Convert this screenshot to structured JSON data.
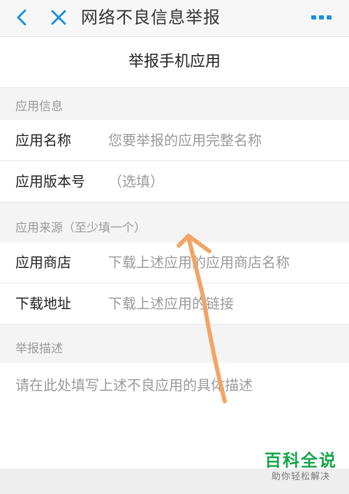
{
  "nav": {
    "title": "网络不良信息举报",
    "back_icon": "chevron-left-icon",
    "close_icon": "close-icon",
    "more_icon": "more-dots-icon",
    "accent_color": "#1a8fe3"
  },
  "subhead": {
    "title": "举报手机应用"
  },
  "sections": {
    "app_info": "应用信息",
    "app_source": "应用来源（至少填一个）",
    "report_desc": "举报描述"
  },
  "fields": {
    "app_name": {
      "label": "应用名称",
      "placeholder": "您要举报的应用完整名称"
    },
    "app_version": {
      "label": "应用版本号",
      "placeholder": "（选填）"
    },
    "app_store": {
      "label": "应用商店",
      "placeholder": "下载上述应用的应用商店名称"
    },
    "download_url": {
      "label": "下载地址",
      "placeholder": "下载上述应用的链接"
    },
    "description": {
      "placeholder": "请在此处填写上述不良应用的具体描述"
    }
  },
  "watermark": {
    "brand": "百科全说",
    "slogan": "助你轻松解决"
  },
  "annotation": {
    "color": "#f2a464"
  }
}
